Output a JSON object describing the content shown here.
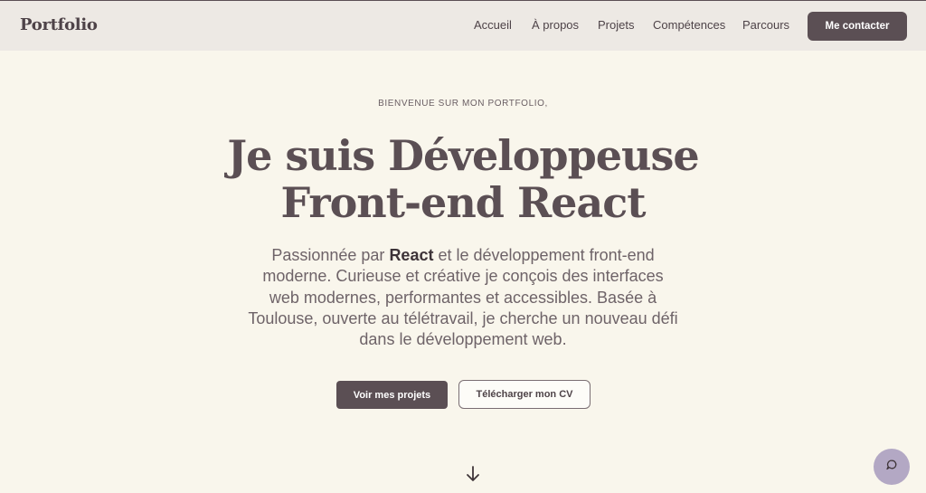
{
  "header": {
    "brand": "Portfolio",
    "nav": [
      "Accueil",
      "À propos",
      "Projets",
      "Compétences",
      "Parcours"
    ],
    "cta": "Me contacter"
  },
  "hero": {
    "eyebrow": "BIENVENUE SUR MON PORTFOLIO,",
    "headline_line1": "Je suis Développeuse",
    "headline_line2": "Front-end React",
    "intro_before": "Passionnée par ",
    "intro_bold": "React",
    "intro_after": " et le développement front-end moderne. Curieuse et créative je conçois des interfaces web modernes, performantes et accessibles. Basée à Toulouse, ouverte au télétravail, je cherche un nouveau défi dans le développement web.",
    "primary_button": "Voir mes projets",
    "secondary_button": "Télécharger mon CV"
  },
  "icons": {
    "scroll": "arrow-down-icon",
    "chat": "chat-icon"
  },
  "colors": {
    "background": "#f9f6ec",
    "header": "#ede9e4",
    "primary": "#5b4f54",
    "chat": "#b3a8c4"
  }
}
